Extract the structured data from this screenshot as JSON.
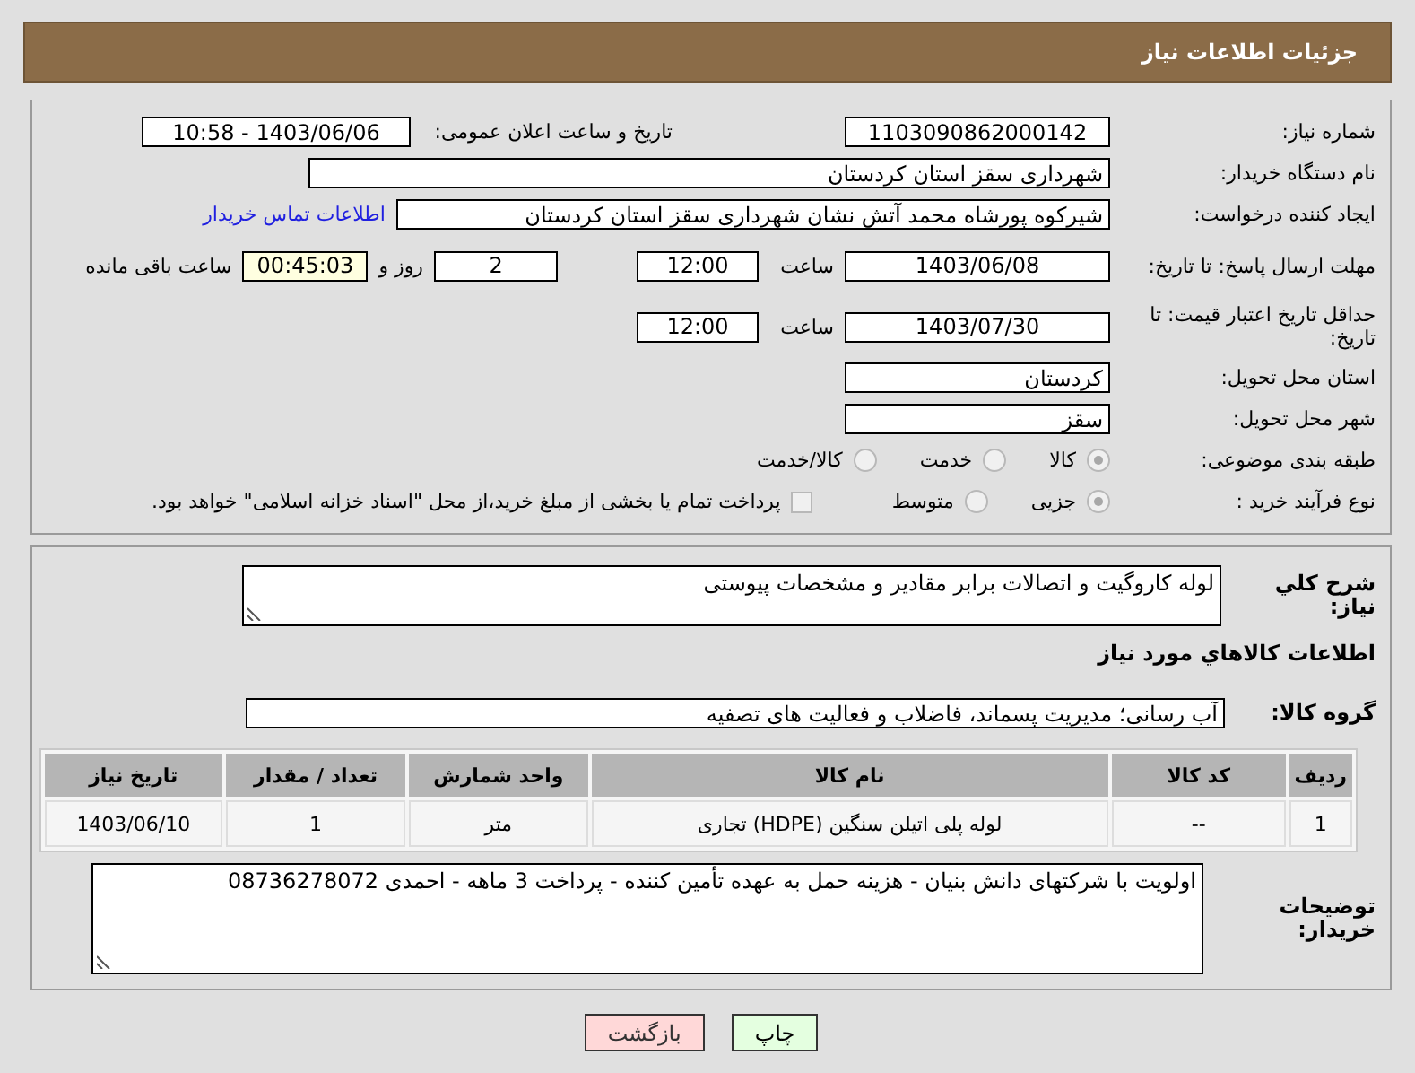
{
  "header": {
    "title": "جزئیات اطلاعات نیاز"
  },
  "fields": {
    "need_number": {
      "label": "شماره نیاز:",
      "value": "1103090862000142"
    },
    "announce": {
      "label": "تاریخ و ساعت اعلان عمومی:",
      "value": "1403/06/06 - 10:58"
    },
    "buyer": {
      "label": "نام دستگاه خریدار:",
      "value": "شهرداری سقز استان کردستان"
    },
    "creator": {
      "label": "ایجاد کننده درخواست:",
      "value": "شیرکوه پورشاه محمد آتش نشان شهرداری سقز استان کردستان",
      "link": "اطلاعات تماس خریدار"
    },
    "deadline": {
      "label": "مهلت ارسال پاسخ: تا تاریخ:",
      "date": "1403/06/08",
      "time_label": "ساعت",
      "time": "12:00",
      "days": "2",
      "days_label": "روز و",
      "remaining": "00:45:03",
      "remaining_label": "ساعت باقی مانده"
    },
    "validity": {
      "label": "حداقل تاریخ اعتبار قیمت: تا تاریخ:",
      "date": "1403/07/30",
      "time_label": "ساعت",
      "time": "12:00"
    },
    "province": {
      "label": "استان محل تحویل:",
      "value": "کردستان"
    },
    "city": {
      "label": "شهر محل تحویل:",
      "value": "سقز"
    },
    "category": {
      "label": "طبقه بندی موضوعی:",
      "options": [
        {
          "label": "کالا",
          "selected": true
        },
        {
          "label": "خدمت",
          "selected": false
        },
        {
          "label": "کالا/خدمت",
          "selected": false
        }
      ]
    },
    "process": {
      "label": "نوع فرآیند خرید :",
      "options": [
        {
          "label": "جزیی",
          "selected": true
        },
        {
          "label": "متوسط",
          "selected": false
        }
      ],
      "payment": {
        "label": "پرداخت تمام یا بخشی از مبلغ خرید،از محل \"اسناد خزانه اسلامی\" خواهد بود.",
        "checked": false
      }
    }
  },
  "description": {
    "label": "شرح كلي نياز:",
    "value": "لوله کاروگیت و اتصالات برابر مقادیر و مشخصات پیوستی"
  },
  "goods_heading": "اطلاعات كالاهاي مورد نياز",
  "goods_group": {
    "label": "گروه كالا:",
    "value": "آب رسانی؛ مدیریت پسماند، فاضلاب و فعالیت های تصفیه"
  },
  "table": {
    "columns": [
      "ردیف",
      "کد کالا",
      "نام کالا",
      "واحد شمارش",
      "تعداد / مقدار",
      "تاریخ نیاز"
    ],
    "rows": [
      [
        "1",
        "--",
        "لوله پلی اتیلن سنگین (HDPE) تجاری",
        "متر",
        "1",
        "1403/06/10"
      ]
    ]
  },
  "buyer_notes": {
    "label": "توضیحات خریدار:",
    "value": "اولویت با شرکتهای دانش بنیان - هزینه حمل به عهده تأمین کننده - پرداخت 3 ماهه - احمدی 08736278072"
  },
  "buttons": [
    {
      "kind": "print",
      "label": "چاپ"
    },
    {
      "kind": "back",
      "label": "بازگشت"
    }
  ]
}
